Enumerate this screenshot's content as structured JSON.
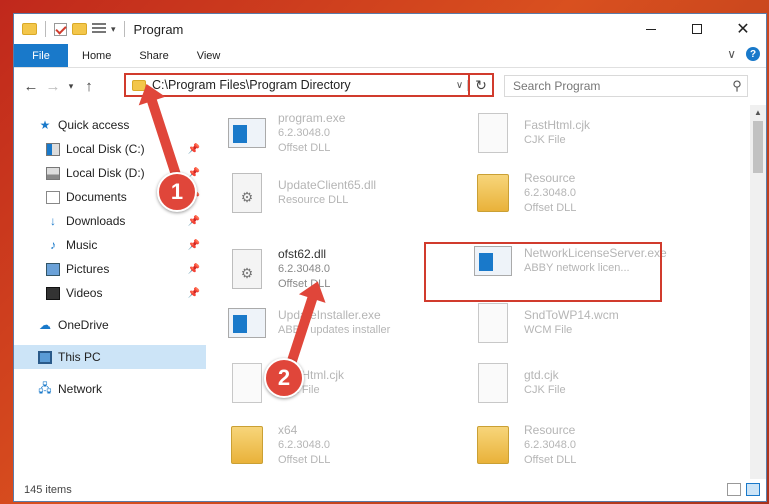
{
  "window": {
    "title": "Program"
  },
  "ribbon": {
    "tabs": [
      "File",
      "Home",
      "Share",
      "View"
    ]
  },
  "address": {
    "path": "C:\\Program Files\\Program Directory"
  },
  "search": {
    "placeholder": "Search Program"
  },
  "sidebar": {
    "items": [
      {
        "label": "Quick access",
        "icon": "star-icon"
      },
      {
        "label": "Local Disk (C:)",
        "icon": "drive-icon",
        "pinned": true
      },
      {
        "label": "Local Disk (D:)",
        "icon": "drive-icon",
        "pinned": true
      },
      {
        "label": "Documents",
        "icon": "document-icon",
        "pinned": true
      },
      {
        "label": "Downloads",
        "icon": "download-icon",
        "pinned": true
      },
      {
        "label": "Music",
        "icon": "music-icon",
        "pinned": true
      },
      {
        "label": "Pictures",
        "icon": "picture-icon",
        "pinned": true
      },
      {
        "label": "Videos",
        "icon": "video-icon",
        "pinned": true
      },
      {
        "label": "OneDrive",
        "icon": "cloud-icon"
      },
      {
        "label": "This PC",
        "icon": "computer-icon",
        "selected": true
      },
      {
        "label": "Network",
        "icon": "network-icon"
      }
    ]
  },
  "files": [
    {
      "name": "program.exe",
      "line1": "6.2.3048.0",
      "line2": "Offset DLL"
    },
    {
      "name": "FastHtml.cjk",
      "line1": "CJK File",
      "line2": ""
    },
    {
      "name": "UpdateClient65.dll",
      "line1": "Resource DLL",
      "line2": ""
    },
    {
      "name": "Resource",
      "line1": "6.2.3048.0",
      "line2": "Offset DLL"
    },
    {
      "name": "ofst62.dll",
      "line1": "6.2.3048.0",
      "line2": "Offset DLL"
    },
    {
      "name": "NetworkLicenseServer.exe",
      "line1": "ABBY network licen...",
      "line2": ""
    },
    {
      "name": "UpdateInstaller.exe",
      "line1": "ABBY updates installer",
      "line2": ""
    },
    {
      "name": "SndToWP14.wcm",
      "line1": "WCM File",
      "line2": ""
    },
    {
      "name": "FastHtml.cjk",
      "line1": "CJK File",
      "line2": ""
    },
    {
      "name": "gtd.cjk",
      "line1": "CJK File",
      "line2": ""
    },
    {
      "name": "x64",
      "line1": "6.2.3048.0",
      "line2": "Offset DLL"
    },
    {
      "name": "Resource",
      "line1": "6.2.3048.0",
      "line2": "Offset DLL"
    }
  ],
  "status": {
    "count": "145 items"
  },
  "annotations": {
    "step1": "1",
    "step2": "2"
  }
}
